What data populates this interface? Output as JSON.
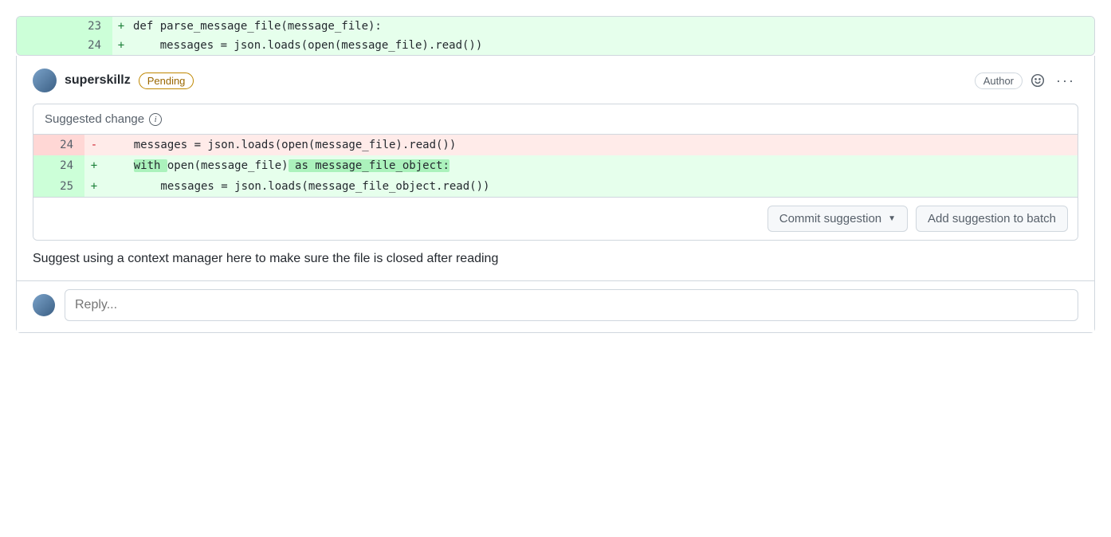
{
  "diff": {
    "lines": [
      {
        "num": "23",
        "marker": "+",
        "code": "def parse_message_file(message_file):"
      },
      {
        "num": "24",
        "marker": "+",
        "code": "    messages = json.loads(open(message_file).read())"
      }
    ]
  },
  "comment": {
    "username": "superskillz",
    "pending_label": "Pending",
    "author_label": "Author",
    "text": "Suggest using a context manager here to make sure the file is closed after reading"
  },
  "suggestion": {
    "title": "Suggested change",
    "lines": {
      "del": {
        "num": "24",
        "marker": "-",
        "code": "    messages = json.loads(open(message_file).read())"
      },
      "add1": {
        "num": "24",
        "marker": "+",
        "seg1": "    ",
        "hl1": "with ",
        "seg2": "open(message_file)",
        "hl2": " as message_file_object:"
      },
      "add2": {
        "num": "25",
        "marker": "+",
        "code": "        messages = json.loads(message_file_object.read())"
      }
    },
    "commit_label": "Commit suggestion",
    "batch_label": "Add suggestion to batch"
  },
  "reply": {
    "placeholder": "Reply..."
  }
}
